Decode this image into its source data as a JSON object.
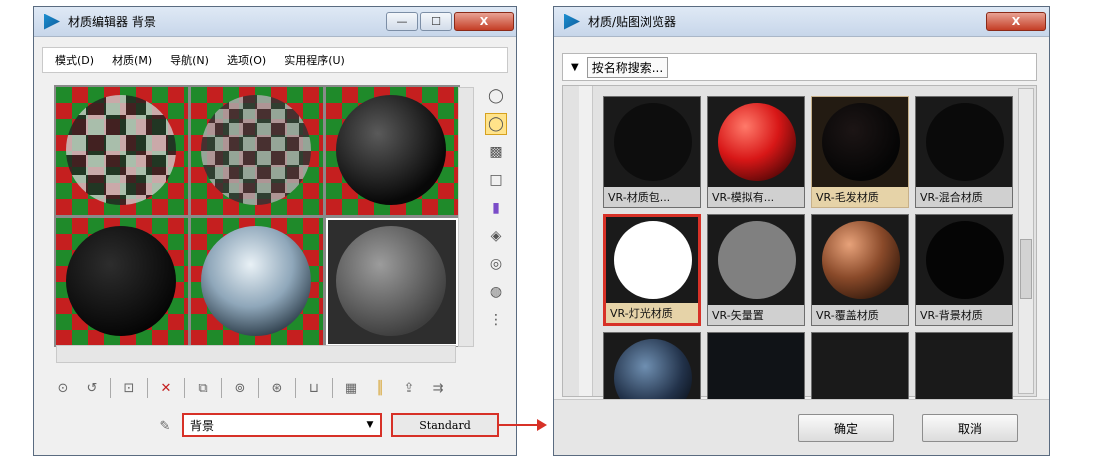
{
  "editor": {
    "title": "材质编辑器  背景",
    "menu": [
      "模式(D)",
      "材质(M)",
      "导航(N)",
      "选项(O)",
      "实用程序(U)"
    ],
    "dropdown_value": "背景",
    "material_type_button": "Standard"
  },
  "browser": {
    "title": "材质/贴图浏览器",
    "search_placeholder": "按名称搜索...",
    "tiles": [
      {
        "label": "VR-材质包...",
        "sphere_color": "#000000"
      },
      {
        "label": "VR-模拟有...",
        "sphere_color": "#d81717"
      },
      {
        "label": "VR-毛发材质",
        "sphere_color": "#050505"
      },
      {
        "label": "VR-混合材质",
        "sphere_color": "#000000"
      },
      {
        "label": "VR-灯光材质",
        "sphere_color": "#ffffff"
      },
      {
        "label": "VR-矢量置",
        "sphere_color": "#808080"
      },
      {
        "label": "VR-覆盖材质",
        "sphere_color": "#8a4a2a"
      },
      {
        "label": "VR-背景材质",
        "sphere_color": "#050505"
      },
      {
        "label": "",
        "sphere_color": "#22324a"
      },
      {
        "label": "",
        "sphere_color": "#111418"
      },
      {
        "label": "",
        "sphere_color": "#111111"
      },
      {
        "label": "",
        "sphere_color": "#111111"
      }
    ],
    "ok_label": "确定",
    "cancel_label": "取消"
  },
  "colors": {
    "highlight": "#d73127",
    "titlebar": "#c7d6ea"
  },
  "icons": [
    "sample-type-icon",
    "backlight-icon",
    "background-icon",
    "uv-tiling-icon",
    "video-check-icon",
    "make-preview-icon",
    "options-icon",
    "select-by-material-icon",
    "material-map-navigator-icon",
    "get-material-icon",
    "put-to-scene-icon",
    "assign-to-selection-icon",
    "reset-icon",
    "copy-icon",
    "unique-icon",
    "put-to-library-icon",
    "effects-channel-icon",
    "show-map-icon",
    "show-end-result-icon",
    "go-to-parent-icon",
    "go-forward-icon",
    "eyedropper-icon"
  ]
}
